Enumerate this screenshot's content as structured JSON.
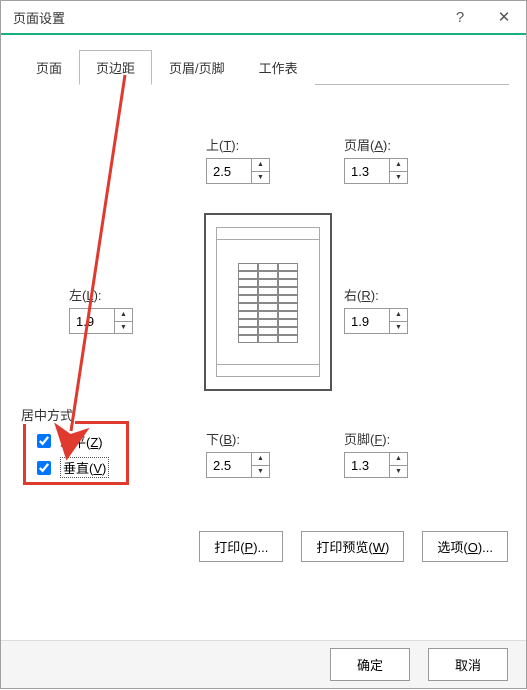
{
  "window": {
    "title": "页面设置",
    "help": "?",
    "close": "✕"
  },
  "tabs": {
    "page": "页面",
    "margins": "页边距",
    "headerfooter": "页眉/页脚",
    "sheet": "工作表"
  },
  "margins": {
    "top_label": "上(T):",
    "top_value": "2.5",
    "header_label": "页眉(A):",
    "header_value": "1.3",
    "left_label": "左(L):",
    "left_value": "1.9",
    "right_label": "右(R):",
    "right_value": "1.9",
    "bottom_label": "下(B):",
    "bottom_value": "2.5",
    "footer_label": "页脚(F):",
    "footer_value": "1.3"
  },
  "center": {
    "group_label": "居中方式",
    "horiz": "水平(Z)",
    "vert": "垂直(V)",
    "horiz_checked": true,
    "vert_checked": true
  },
  "buttons": {
    "print": "打印(P)...",
    "preview": "打印预览(W)",
    "options": "选项(O)...",
    "ok": "确定",
    "cancel": "取消"
  },
  "underline_map": {
    "top": "T",
    "header": "A",
    "left": "L",
    "right": "R",
    "bottom": "B",
    "footer": "F",
    "horiz": "Z",
    "vert": "V",
    "print": "P",
    "preview": "W",
    "options": "O"
  }
}
